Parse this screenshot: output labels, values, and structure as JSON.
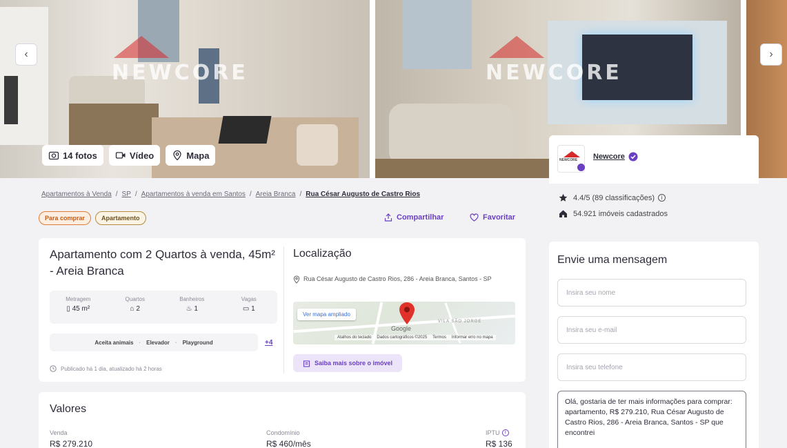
{
  "gallery": {
    "watermark": "NEWCORE",
    "tabs": [
      {
        "label": "14 fotos",
        "icon": "camera-icon"
      },
      {
        "label": "Vídeo",
        "icon": "video-icon"
      },
      {
        "label": "Mapa",
        "icon": "map-pin-icon"
      }
    ],
    "prev_label": "‹",
    "next_label": "›"
  },
  "breadcrumb": {
    "items": [
      "Apartamentos à Venda",
      "SP",
      "Apartamentos à venda em Santos",
      "Areia Branca"
    ],
    "separator": "/",
    "current": "Rua César Augusto de Castro Rios"
  },
  "badges": {
    "sale": "Para comprar",
    "type": "Apartamento"
  },
  "actions": {
    "share": "Compartilhar",
    "favorite": "Favoritar"
  },
  "listing": {
    "title": "Apartamento com 2 Quartos à venda, 45m² - Areia Branca",
    "specs": [
      {
        "label": "Metragem",
        "value": "45 m²",
        "icon": "ruler-icon"
      },
      {
        "label": "Quartos",
        "value": "2",
        "icon": "bed-icon"
      },
      {
        "label": "Banheiros",
        "value": "1",
        "icon": "bath-icon"
      },
      {
        "label": "Vagas",
        "value": "1",
        "icon": "car-icon"
      }
    ],
    "features": [
      "Aceita animais",
      "Elevador",
      "Playground"
    ],
    "features_more": "+4",
    "published": "Publicado há 1 dia, atualizado há 2 horas"
  },
  "location": {
    "title": "Localização",
    "address": "Rua César Augusto de Castro Rios, 286 - Areia Branca, Santos - SP",
    "map_button": "Ver mapa ampliado",
    "map_google": "Google",
    "map_area": "VILA SÃO JORGE",
    "map_footer": [
      "Atalhos do teclado",
      "Dados cartográficos ©2025",
      "Termos",
      "Informar erro no mapa"
    ],
    "more_button": "Saiba mais sobre o imóvel"
  },
  "values": {
    "title": "Valores",
    "items": [
      {
        "label": "Venda",
        "value": "R$ 279.210"
      },
      {
        "label": "Condomínio",
        "value": "R$ 460/mês"
      },
      {
        "label": "IPTU",
        "value": "R$ 136"
      }
    ]
  },
  "agency": {
    "name": "Newcore",
    "logo_text": "NEWCORE",
    "rating": "4.4/5 (89 classificações)",
    "properties": "54.921 imóveis cadastrados"
  },
  "contact": {
    "title": "Envie uma mensagem",
    "name_placeholder": "Insira seu nome",
    "email_placeholder": "Insira seu e-mail",
    "phone_placeholder": "Insira seu telefone",
    "message": "Olá, gostaria de ter mais informações para comprar: apartamento, R$ 279.210, Rua César Augusto de Castro Rios, 286 - Areia Branca, Santos - SP que encontrei"
  },
  "colors": {
    "accent": "#6a3fc1",
    "brand_red": "#d62828",
    "background": "#f2f2f5"
  }
}
